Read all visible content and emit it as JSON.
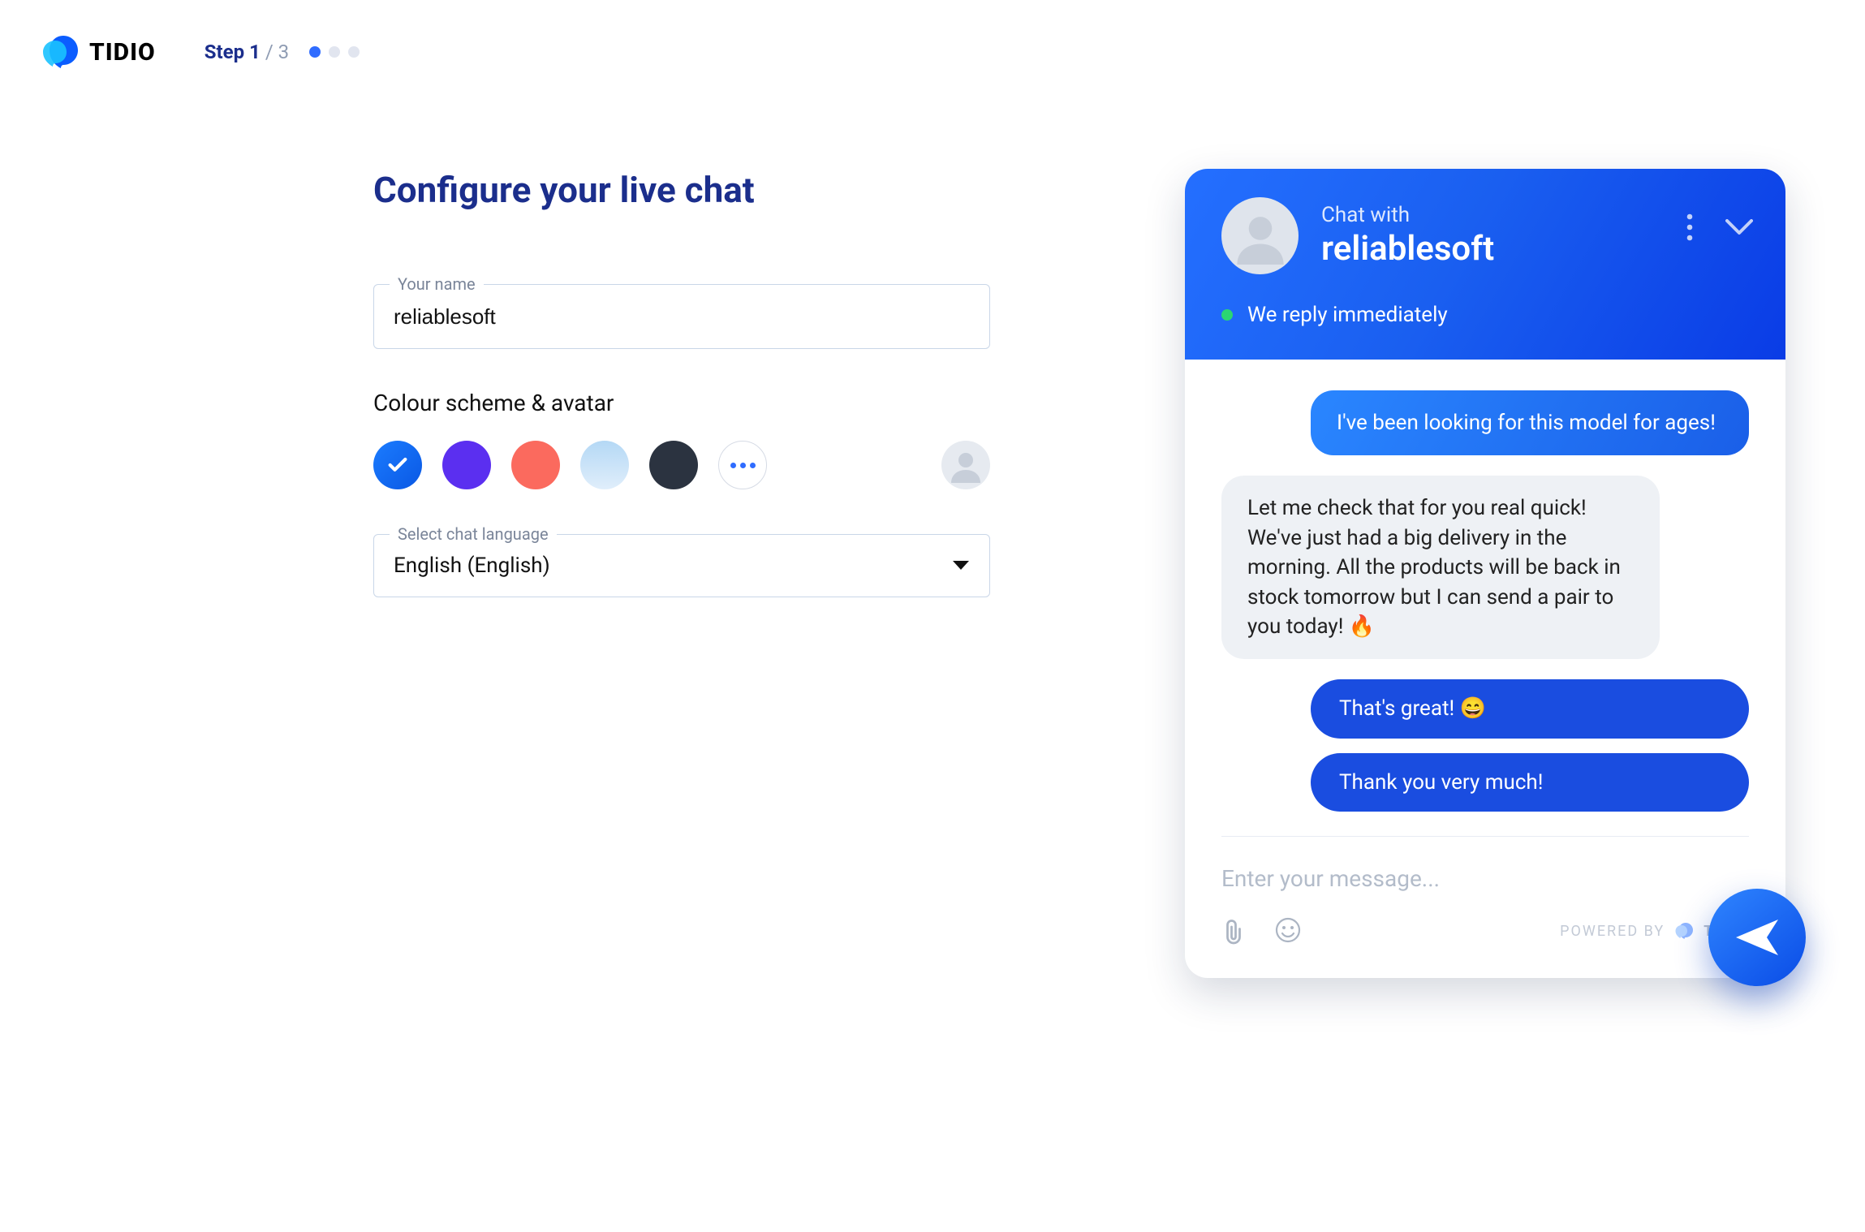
{
  "brand": "TIDIO",
  "step": {
    "current_label": "Step 1",
    "total_label": " / 3"
  },
  "title": "Configure your live chat",
  "nameField": {
    "label": "Your name",
    "value": "reliablesoft"
  },
  "colorSection": {
    "label": "Colour scheme & avatar"
  },
  "langField": {
    "label": "Select chat language",
    "value": "English (English)"
  },
  "preview": {
    "header_line1": "Chat with",
    "header_line2": "reliablesoft",
    "reply_text": "We reply immediately",
    "msg1": "I've been looking for this model for ages!",
    "msg2": "Let me check that for you real quick! We've just had a big delivery in the morning. All the products will be back in stock tomorrow but I can send a pair to you today! 🔥",
    "msg3": "That's great! 😄",
    "msg4": "Thank you very much!",
    "input_placeholder": "Enter your message...",
    "powered_label": "POWERED BY",
    "powered_brand": "TIDIO"
  }
}
